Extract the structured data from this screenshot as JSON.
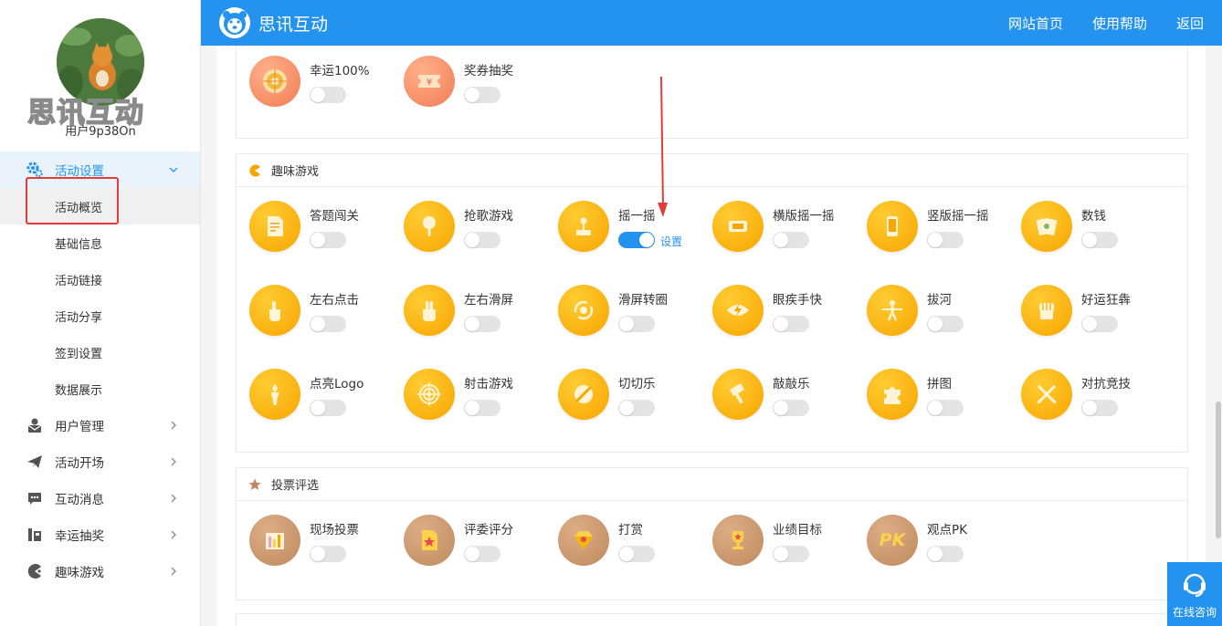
{
  "user": {
    "brand_text": "思讯互动",
    "name": "用户9p38On"
  },
  "sidebar": {
    "active_menu": "活动设置",
    "sub_items": [
      "活动概览",
      "基础信息",
      "活动链接",
      "活动分享",
      "签到设置",
      "数据展示"
    ],
    "menus": [
      "用户管理",
      "活动开场",
      "互动消息",
      "幸运抽奖",
      "趣味游戏"
    ]
  },
  "header": {
    "title": "思讯互动",
    "nav": [
      "网站首页",
      "使用帮助",
      "返回"
    ]
  },
  "sections": {
    "top_cards": [
      {
        "label": "幸运100%",
        "icon": "wheel-icon",
        "on": false
      },
      {
        "label": "奖券抽奖",
        "icon": "ticket-icon",
        "on": false
      }
    ],
    "games": {
      "title": "趣味游戏",
      "cards": [
        {
          "label": "答题闯关",
          "icon": "quiz-doc-icon",
          "on": false
        },
        {
          "label": "抢歌游戏",
          "icon": "microphone-icon",
          "on": false
        },
        {
          "label": "摇一摇",
          "icon": "joystick-icon",
          "on": true,
          "link": "设置"
        },
        {
          "label": "横版摇一摇",
          "icon": "phone-landscape-icon",
          "on": false
        },
        {
          "label": "竖版摇一摇",
          "icon": "phone-portrait-icon",
          "on": false
        },
        {
          "label": "数钱",
          "icon": "money-icon",
          "on": false
        },
        {
          "label": "左右点击",
          "icon": "tap-hand-icon",
          "on": false
        },
        {
          "label": "左右滑屏",
          "icon": "swipe-hand-icon",
          "on": false
        },
        {
          "label": "滑屏转圈",
          "icon": "rotate-icon",
          "on": false
        },
        {
          "label": "眼疾手快",
          "icon": "eye-icon",
          "on": false
        },
        {
          "label": "拔河",
          "icon": "tug-of-war-icon",
          "on": false
        },
        {
          "label": "好运狂犇",
          "icon": "fist-icon",
          "on": false
        },
        {
          "label": "点亮Logo",
          "icon": "torch-icon",
          "on": false
        },
        {
          "label": "射击游戏",
          "icon": "target-icon",
          "on": false
        },
        {
          "label": "切切乐",
          "icon": "slice-icon",
          "on": false
        },
        {
          "label": "敲敲乐",
          "icon": "hammer-icon",
          "on": false
        },
        {
          "label": "拼图",
          "icon": "puzzle-icon",
          "on": false
        },
        {
          "label": "对抗竞技",
          "icon": "swords-icon",
          "on": false
        }
      ]
    },
    "vote": {
      "title": "投票评选",
      "cards": [
        {
          "label": "现场投票",
          "icon": "bar-chart-icon",
          "on": false
        },
        {
          "label": "评委评分",
          "icon": "star-doc-icon",
          "on": false
        },
        {
          "label": "打赏",
          "icon": "diamond-icon",
          "on": false
        },
        {
          "label": "业绩目标",
          "icon": "trophy-icon",
          "on": false
        },
        {
          "label": "观点PK",
          "icon": "pk-icon",
          "on": false,
          "icon_text": "PK"
        }
      ]
    }
  },
  "consult": {
    "label": "在线咨询"
  },
  "colors": {
    "primary": "#2493ef",
    "orange": "#f7a500",
    "brown": "#c0895e",
    "highlight": "#e43b3b"
  }
}
